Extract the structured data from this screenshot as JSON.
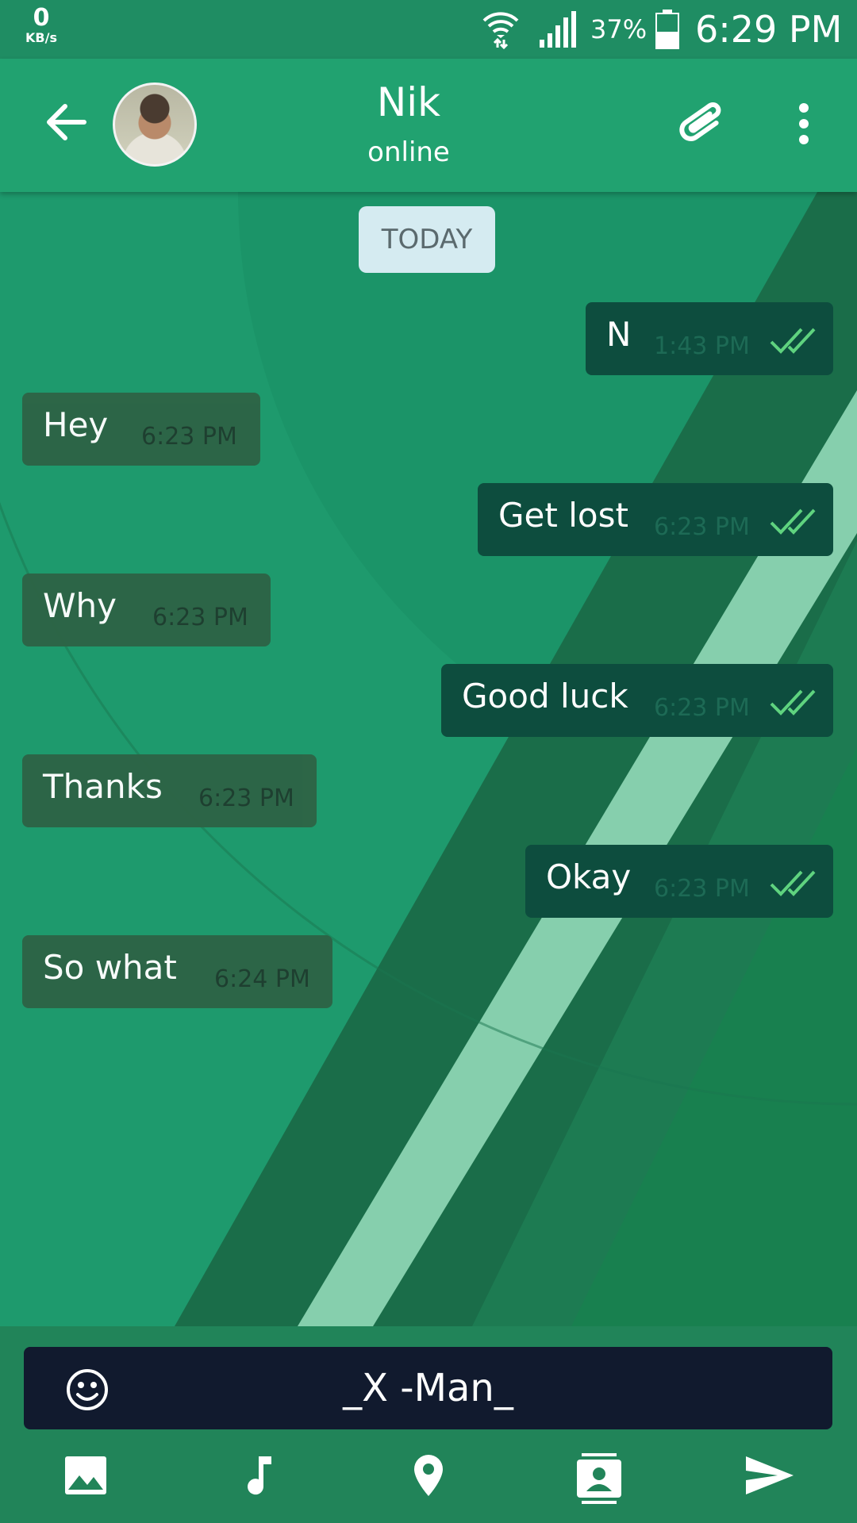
{
  "status_bar": {
    "net_speed_value": "0",
    "net_speed_unit": "KB/s",
    "battery_percent": "37%",
    "time": "6:29 PM"
  },
  "header": {
    "contact_name": "Nik",
    "contact_status": "online",
    "icons": [
      "back-arrow-icon",
      "avatar",
      "paperclip-icon",
      "overflow-menu-icon"
    ]
  },
  "chat": {
    "date_separator": "TODAY",
    "messages": [
      {
        "direction": "out",
        "text": "N",
        "time": "1:43 PM",
        "read": true
      },
      {
        "direction": "in",
        "text": "Hey",
        "time": "6:23 PM"
      },
      {
        "direction": "out",
        "text": "Get lost",
        "time": "6:23 PM",
        "read": true
      },
      {
        "direction": "in",
        "text": "Why",
        "time": "6:23 PM"
      },
      {
        "direction": "out",
        "text": "Good luck",
        "time": "6:23 PM",
        "read": true
      },
      {
        "direction": "in",
        "text": "Thanks",
        "time": "6:23 PM"
      },
      {
        "direction": "out",
        "text": "Okay",
        "time": "6:23 PM",
        "read": true
      },
      {
        "direction": "in",
        "text": "So what",
        "time": "6:24 PM"
      }
    ]
  },
  "composer": {
    "input_value": "_X -Man_",
    "actions": [
      "gallery-icon",
      "music-icon",
      "location-icon",
      "contact-card-icon",
      "send-icon"
    ]
  },
  "colors": {
    "header": "#21a270",
    "status_bar": "#1f8d63",
    "bubble_in": "#2d6446",
    "bubble_out": "#0d4d3e",
    "read_ticks": "#5fd37f",
    "input_bg": "#111a2e"
  }
}
